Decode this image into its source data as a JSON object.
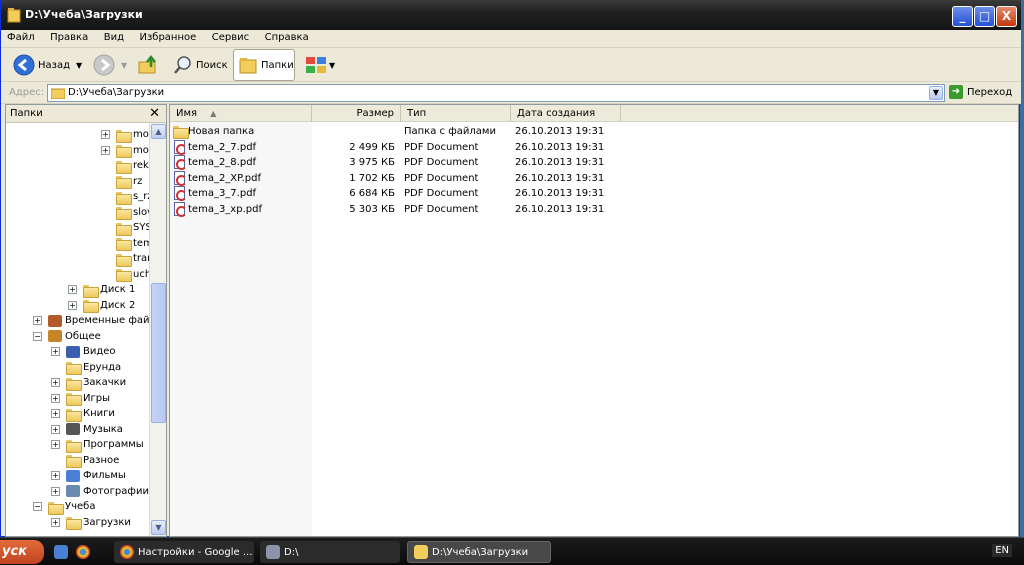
{
  "window": {
    "title": "D:\\Учеба\\Загрузки",
    "buttons": {
      "minimize": "_",
      "maximize": "□",
      "close": "X"
    }
  },
  "menu": [
    "Файл",
    "Правка",
    "Вид",
    "Избранное",
    "Сервис",
    "Справка"
  ],
  "toolbar": {
    "back": "Назад",
    "search": "Поиск",
    "folders": "Папки"
  },
  "address": {
    "label": "Адрес:",
    "value": "D:\\Учеба\\Загрузки",
    "go": "Переход"
  },
  "left_pane": {
    "title": "Папки",
    "close": "✕",
    "tree": [
      {
        "label": "moc",
        "pm": "+",
        "icon": "folder"
      },
      {
        "label": "moc",
        "pm": "+",
        "icon": "folder"
      },
      {
        "label": "rekl",
        "pm": "",
        "icon": "folder"
      },
      {
        "label": "rz",
        "pm": "",
        "icon": "folder"
      },
      {
        "label": "s_rz",
        "pm": "",
        "icon": "folder"
      },
      {
        "label": "slov",
        "pm": "",
        "icon": "folder"
      },
      {
        "label": "SYS",
        "pm": "",
        "icon": "folder"
      },
      {
        "label": "tem",
        "pm": "",
        "icon": "folder"
      },
      {
        "label": "trar",
        "pm": "",
        "icon": "folder"
      },
      {
        "label": "uch",
        "pm": "",
        "icon": "folder"
      },
      {
        "label": "Диск 1",
        "pm": "+",
        "icon": "folder"
      },
      {
        "label": "Диск 2",
        "pm": "+",
        "icon": "folder"
      },
      {
        "label": "Временные файлы",
        "pm": "+",
        "icon": "temp"
      },
      {
        "label": "Общее",
        "pm": "−",
        "icon": "shared"
      },
      {
        "label": "Видео",
        "pm": "+",
        "icon": "video"
      },
      {
        "label": "Ерунда",
        "pm": "",
        "icon": "folder"
      },
      {
        "label": "Закачки",
        "pm": "+",
        "icon": "folder"
      },
      {
        "label": "Игры",
        "pm": "+",
        "icon": "folder"
      },
      {
        "label": "Книги",
        "pm": "+",
        "icon": "folder"
      },
      {
        "label": "Музыка",
        "pm": "+",
        "icon": "music"
      },
      {
        "label": "Программы",
        "pm": "+",
        "icon": "folder"
      },
      {
        "label": "Разное",
        "pm": "",
        "icon": "folder"
      },
      {
        "label": "Фильмы",
        "pm": "+",
        "icon": "movies"
      },
      {
        "label": "Фотографии",
        "pm": "+",
        "icon": "photos"
      },
      {
        "label": "Учеба",
        "pm": "−",
        "icon": "folder"
      },
      {
        "label": "Загрузки",
        "pm": "+",
        "icon": "folder"
      }
    ]
  },
  "columns": {
    "name": "Имя",
    "size": "Размер",
    "type": "Тип",
    "created": "Дата создания"
  },
  "files": [
    {
      "name": "Новая папка",
      "size": "",
      "type": "Папка с файлами",
      "created": "26.10.2013 19:31",
      "icon": "folder"
    },
    {
      "name": "tema_2_7.pdf",
      "size": "2 499 КБ",
      "type": "PDF Document",
      "created": "26.10.2013 19:31",
      "icon": "pdf"
    },
    {
      "name": "tema_2_8.pdf",
      "size": "3 975 КБ",
      "type": "PDF Document",
      "created": "26.10.2013 19:31",
      "icon": "pdf"
    },
    {
      "name": "tema_2_XP.pdf",
      "size": "1 702 КБ",
      "type": "PDF Document",
      "created": "26.10.2013 19:31",
      "icon": "pdf"
    },
    {
      "name": "tema_3_7.pdf",
      "size": "6 684 КБ",
      "type": "PDF Document",
      "created": "26.10.2013 19:31",
      "icon": "pdf"
    },
    {
      "name": "tema_3_xp.pdf",
      "size": "5 303 КБ",
      "type": "PDF Document",
      "created": "26.10.2013 19:31",
      "icon": "pdf"
    }
  ],
  "taskbar": {
    "start": "уск",
    "tasks": [
      "Настройки - Google ...",
      "D:\\",
      "D:\\Учеба\\Загрузки"
    ],
    "lang": "EN"
  },
  "colors": {
    "accent": "#0831d9",
    "start": "#c0441f"
  }
}
